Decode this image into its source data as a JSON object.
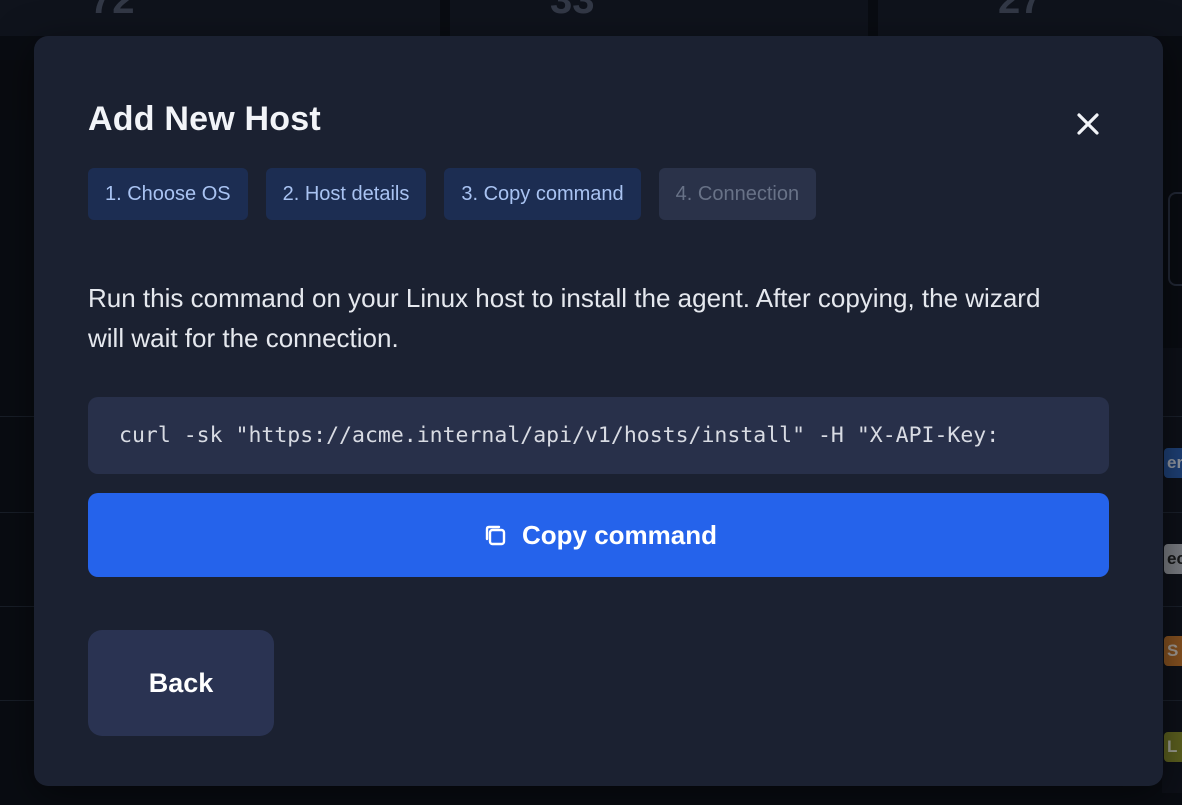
{
  "background": {
    "stat_values": [
      "72",
      "33",
      "27"
    ],
    "badges": [
      {
        "text": "er",
        "color": "#2b5fb0",
        "text_color": "#dfe7f5"
      },
      {
        "text": "ec",
        "color": "#b8bcc4",
        "text_color": "#222"
      },
      {
        "text": "S",
        "color": "#c9782b",
        "text_color": "#f5e9dc"
      },
      {
        "text": "L",
        "color": "#8a8f2a",
        "text_color": "#f0f0dc"
      }
    ]
  },
  "modal": {
    "title": "Add New Host",
    "close_icon": "close-icon",
    "steps": [
      {
        "label": "1. Choose OS",
        "state": "active"
      },
      {
        "label": "2. Host details",
        "state": "active"
      },
      {
        "label": "3. Copy command",
        "state": "active"
      },
      {
        "label": "4. Connection",
        "state": "inactive"
      }
    ],
    "description": "Run this command on your Linux host to install the agent. After copying, the wizard will wait for the connection.",
    "command": "curl -sk \"https://acme.internal/api/v1/hosts/install\" -H \"X-API-Key: ",
    "copy_button": {
      "label": "Copy command",
      "icon": "copy-icon"
    },
    "back_button": {
      "label": "Back"
    }
  },
  "colors": {
    "modal_bg": "#1b2131",
    "accent": "#2563eb",
    "step_active_bg": "#1c2d52",
    "step_active_text": "#a9c3f2",
    "step_inactive_bg": "#2a3249",
    "step_inactive_text": "#687287",
    "command_bg": "#28304a",
    "back_bg": "#2a3352"
  }
}
